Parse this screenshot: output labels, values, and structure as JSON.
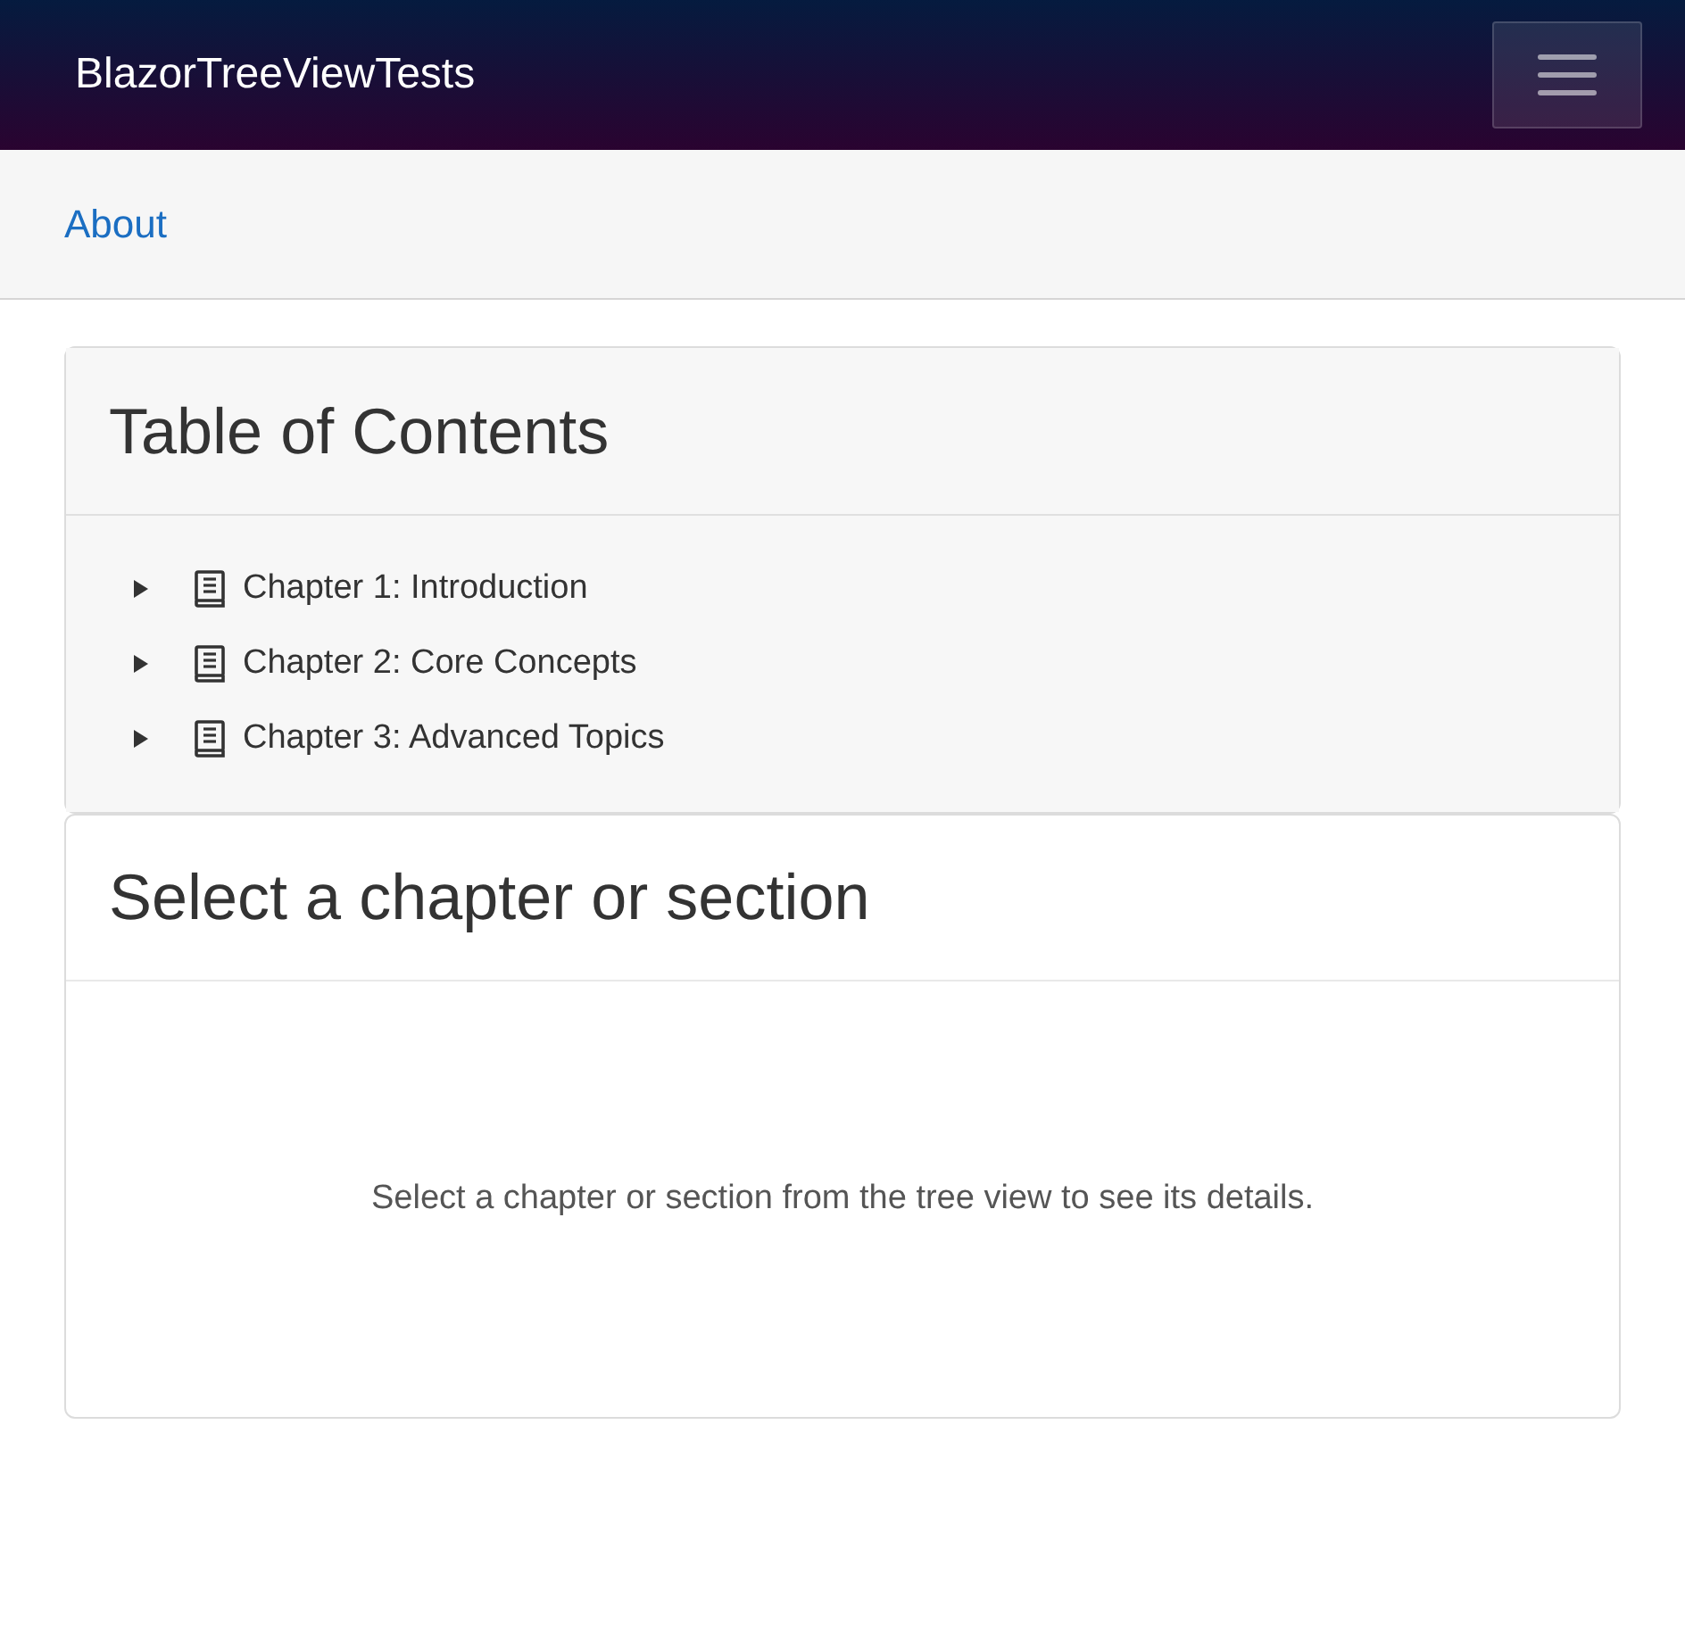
{
  "navbar": {
    "brand": "BlazorTreeViewTests"
  },
  "top_row": {
    "links": [
      "About"
    ]
  },
  "toc": {
    "title": "Table of Contents",
    "items": [
      {
        "label": "Chapter 1: Introduction",
        "expanded": false
      },
      {
        "label": "Chapter 2: Core Concepts",
        "expanded": false
      },
      {
        "label": "Chapter 3: Advanced Topics",
        "expanded": false
      }
    ]
  },
  "details": {
    "title": "Select a chapter or section",
    "message": "Select a chapter or section from the tree view to see its details."
  }
}
